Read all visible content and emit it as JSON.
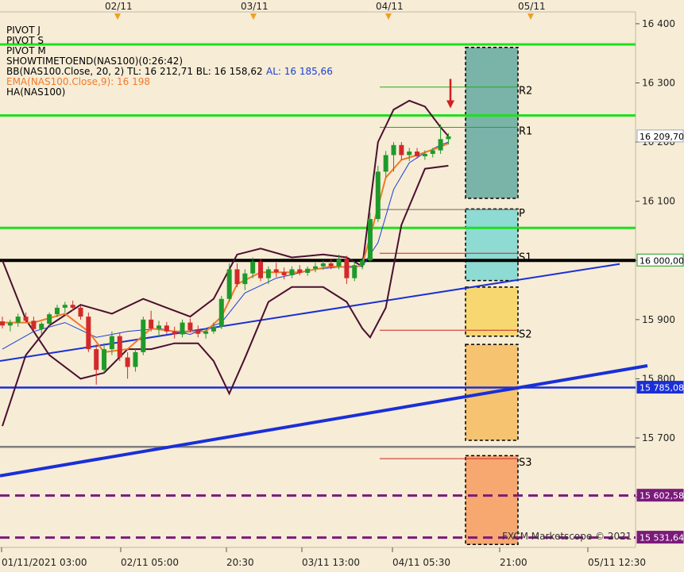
{
  "chart_data": {
    "type": "candlestick",
    "symbol": "NAS100",
    "legend": [
      {
        "text": "PIVOT J",
        "color": "#000000"
      },
      {
        "text": "PIVOT S",
        "color": "#000000"
      },
      {
        "text": "PIVOT M",
        "color": "#000000"
      },
      {
        "text": "SHOWTIMETOEND(NAS100)(0:26:42)",
        "color": "#000000"
      },
      {
        "text": "BB(NAS100.Close, 20, 2)  TL: 16 212,71  BL: 16 158,62",
        "color": "#000000",
        "extra": "AL: 16 185,66",
        "extra_color": "#1a3fd6"
      },
      {
        "text": "EMA(NAS100.Close,9): 16 198",
        "color": "#f07a2a"
      },
      {
        "text": "HA(NAS100)",
        "color": "#000000"
      }
    ],
    "ylim": [
      15515,
      16420
    ],
    "y_ticks": [
      "16 400",
      "16 300",
      "16 200",
      "16 100",
      "16 000",
      "15 900",
      "15 800",
      "15 700",
      "15 600"
    ],
    "y_tick_values": [
      16400,
      16300,
      16200,
      16100,
      16000,
      15900,
      15800,
      15700,
      15600
    ],
    "x_ticks": [
      "01/11/2021 03:00",
      "02/11 05:00",
      "20:30",
      "03/11 13:00",
      "04/11 05:30",
      "21:00",
      "05/11 12:30"
    ],
    "top_date_markers": [
      "02/11",
      "03/11",
      "04/11",
      "05/11"
    ],
    "price_tags": [
      {
        "label": "16 209,70",
        "value": 16209.7,
        "bg": "#ffffff",
        "fg": "#000000",
        "border": "#9ab"
      },
      {
        "label": "16 000,00",
        "value": 16000.0,
        "bg": "#ffffff",
        "fg": "#000000",
        "border": "#1a9a1a"
      },
      {
        "label": "15 785,08",
        "value": 15785.08,
        "bg": "#1a2fd6",
        "fg": "#ffffff",
        "border": "#1a2fd6"
      },
      {
        "label": "15 602,58",
        "value": 15602.58,
        "bg": "#7a1a7a",
        "fg": "#ffffff",
        "border": "#7a1a7a"
      },
      {
        "label": "15 531,64",
        "value": 15531.64,
        "bg": "#7a1a7a",
        "fg": "#ffffff",
        "border": "#7a1a7a"
      }
    ],
    "horizontal_lines": [
      {
        "value": 16365,
        "color": "#1ee01e",
        "style": "solid"
      },
      {
        "value": 16245,
        "color": "#1ee01e",
        "style": "solid"
      },
      {
        "value": 16055,
        "color": "#1ee01e",
        "style": "solid"
      },
      {
        "value": 16000,
        "color": "#000000",
        "style": "solid"
      },
      {
        "value": 15785.08,
        "color": "#1a2fd6",
        "style": "solid"
      },
      {
        "value": 15685,
        "color": "#808080",
        "style": "solid"
      },
      {
        "value": 15602.58,
        "color": "#7a1a7a",
        "style": "dashed"
      },
      {
        "value": 15531.64,
        "color": "#7a1a7a",
        "style": "dashed"
      }
    ],
    "pivot_levels": [
      {
        "label": "R2",
        "value": 16293,
        "line_color": "#22aa22"
      },
      {
        "label": "R1",
        "value": 16225,
        "line_color": "#22aa22"
      },
      {
        "label": "P",
        "value": 16086,
        "line_color": "#666666"
      },
      {
        "label": "S1",
        "value": 16012,
        "line_color": "#cc2222"
      },
      {
        "label": "S2",
        "value": 15882,
        "line_color": "#cc2222"
      },
      {
        "label": "S3",
        "value": 15665,
        "line_color": "#cc2222"
      }
    ],
    "pivot_zones": [
      {
        "from": 16105,
        "to": 16360,
        "color": "#7ab3a8"
      },
      {
        "from": 15966,
        "to": 16087,
        "color": "#8ddbd2"
      },
      {
        "from": 15872,
        "to": 15955,
        "color": "#f7d870"
      },
      {
        "from": 15696,
        "to": 15858,
        "color": "#f6c470"
      },
      {
        "from": 15520,
        "to": 15670,
        "color": "#f6a870"
      }
    ],
    "trendlines": [
      {
        "from": [
          0,
          15830
        ],
        "to": [
          780,
          15994
        ],
        "color": "#1a2fd6",
        "width": 2
      },
      {
        "from": [
          0,
          15636
        ],
        "to": [
          815,
          15822
        ],
        "color": "#1a2fd6",
        "width": 4
      }
    ],
    "candles": [
      {
        "i": 0,
        "o": 15897,
        "h": 15905,
        "l": 15885,
        "c": 15890
      },
      {
        "i": 1,
        "o": 15890,
        "h": 15900,
        "l": 15880,
        "c": 15895
      },
      {
        "i": 2,
        "o": 15895,
        "h": 15910,
        "l": 15888,
        "c": 15905
      },
      {
        "i": 3,
        "o": 15905,
        "h": 15912,
        "l": 15895,
        "c": 15898
      },
      {
        "i": 4,
        "o": 15898,
        "h": 15905,
        "l": 15880,
        "c": 15884
      },
      {
        "i": 5,
        "o": 15884,
        "h": 15896,
        "l": 15876,
        "c": 15893
      },
      {
        "i": 6,
        "o": 15893,
        "h": 15912,
        "l": 15889,
        "c": 15909
      },
      {
        "i": 7,
        "o": 15909,
        "h": 15925,
        "l": 15904,
        "c": 15920
      },
      {
        "i": 8,
        "o": 15920,
        "h": 15930,
        "l": 15912,
        "c": 15925
      },
      {
        "i": 9,
        "o": 15925,
        "h": 15932,
        "l": 15915,
        "c": 15920
      },
      {
        "i": 10,
        "o": 15920,
        "h": 15924,
        "l": 15900,
        "c": 15905
      },
      {
        "i": 11,
        "o": 15905,
        "h": 15912,
        "l": 15845,
        "c": 15850
      },
      {
        "i": 12,
        "o": 15850,
        "h": 15858,
        "l": 15790,
        "c": 15815
      },
      {
        "i": 13,
        "o": 15815,
        "h": 15860,
        "l": 15810,
        "c": 15850
      },
      {
        "i": 14,
        "o": 15850,
        "h": 15880,
        "l": 15840,
        "c": 15872
      },
      {
        "i": 15,
        "o": 15872,
        "h": 15878,
        "l": 15830,
        "c": 15836
      },
      {
        "i": 16,
        "o": 15836,
        "h": 15845,
        "l": 15800,
        "c": 15820
      },
      {
        "i": 17,
        "o": 15820,
        "h": 15850,
        "l": 15812,
        "c": 15845
      },
      {
        "i": 18,
        "o": 15845,
        "h": 15905,
        "l": 15840,
        "c": 15900
      },
      {
        "i": 19,
        "o": 15900,
        "h": 15915,
        "l": 15880,
        "c": 15885
      },
      {
        "i": 20,
        "o": 15885,
        "h": 15898,
        "l": 15870,
        "c": 15890
      },
      {
        "i": 21,
        "o": 15890,
        "h": 15896,
        "l": 15876,
        "c": 15880
      },
      {
        "i": 22,
        "o": 15880,
        "h": 15888,
        "l": 15868,
        "c": 15875
      },
      {
        "i": 23,
        "o": 15875,
        "h": 15900,
        "l": 15870,
        "c": 15895
      },
      {
        "i": 24,
        "o": 15895,
        "h": 15902,
        "l": 15878,
        "c": 15882
      },
      {
        "i": 25,
        "o": 15882,
        "h": 15890,
        "l": 15870,
        "c": 15876
      },
      {
        "i": 26,
        "o": 15876,
        "h": 15885,
        "l": 15868,
        "c": 15880
      },
      {
        "i": 27,
        "o": 15880,
        "h": 15895,
        "l": 15876,
        "c": 15888
      },
      {
        "i": 28,
        "o": 15888,
        "h": 15940,
        "l": 15884,
        "c": 15935
      },
      {
        "i": 29,
        "o": 15935,
        "h": 15995,
        "l": 15930,
        "c": 15985
      },
      {
        "i": 30,
        "o": 15985,
        "h": 15995,
        "l": 15955,
        "c": 15960
      },
      {
        "i": 31,
        "o": 15960,
        "h": 15985,
        "l": 15950,
        "c": 15978
      },
      {
        "i": 32,
        "o": 15978,
        "h": 16005,
        "l": 15970,
        "c": 15998
      },
      {
        "i": 33,
        "o": 15998,
        "h": 16003,
        "l": 15965,
        "c": 15970
      },
      {
        "i": 34,
        "o": 15970,
        "h": 15990,
        "l": 15960,
        "c": 15985
      },
      {
        "i": 35,
        "o": 15985,
        "h": 15996,
        "l": 15972,
        "c": 15980
      },
      {
        "i": 36,
        "o": 15980,
        "h": 15988,
        "l": 15968,
        "c": 15975
      },
      {
        "i": 37,
        "o": 15975,
        "h": 15990,
        "l": 15970,
        "c": 15985
      },
      {
        "i": 38,
        "o": 15985,
        "h": 15992,
        "l": 15975,
        "c": 15979
      },
      {
        "i": 39,
        "o": 15979,
        "h": 15990,
        "l": 15974,
        "c": 15986
      },
      {
        "i": 40,
        "o": 15986,
        "h": 15996,
        "l": 15980,
        "c": 15990
      },
      {
        "i": 41,
        "o": 15990,
        "h": 16000,
        "l": 15984,
        "c": 15995
      },
      {
        "i": 42,
        "o": 15995,
        "h": 16003,
        "l": 15985,
        "c": 15990
      },
      {
        "i": 43,
        "o": 15990,
        "h": 16010,
        "l": 15985,
        "c": 16002
      },
      {
        "i": 44,
        "o": 16002,
        "h": 16008,
        "l": 15960,
        "c": 15970
      },
      {
        "i": 45,
        "o": 15970,
        "h": 15998,
        "l": 15965,
        "c": 15992
      },
      {
        "i": 46,
        "o": 15992,
        "h": 16005,
        "l": 15985,
        "c": 16000
      },
      {
        "i": 47,
        "o": 16000,
        "h": 16080,
        "l": 15998,
        "c": 16070
      },
      {
        "i": 48,
        "o": 16070,
        "h": 16160,
        "l": 16065,
        "c": 16150
      },
      {
        "i": 49,
        "o": 16150,
        "h": 16185,
        "l": 16140,
        "c": 16178
      },
      {
        "i": 50,
        "o": 16178,
        "h": 16200,
        "l": 16150,
        "c": 16195
      },
      {
        "i": 51,
        "o": 16195,
        "h": 16200,
        "l": 16170,
        "c": 16178
      },
      {
        "i": 52,
        "o": 16178,
        "h": 16190,
        "l": 16168,
        "c": 16184
      },
      {
        "i": 53,
        "o": 16184,
        "h": 16190,
        "l": 16172,
        "c": 16176
      },
      {
        "i": 54,
        "o": 16176,
        "h": 16186,
        "l": 16170,
        "c": 16180
      },
      {
        "i": 55,
        "o": 16180,
        "h": 16190,
        "l": 16174,
        "c": 16186
      },
      {
        "i": 56,
        "o": 16186,
        "h": 16230,
        "l": 16180,
        "c": 16205
      },
      {
        "i": 57,
        "o": 16205,
        "h": 16215,
        "l": 16196,
        "c": 16209.7
      }
    ],
    "bb_upper": [
      [
        0,
        15720
      ],
      [
        3,
        15840
      ],
      [
        6,
        15890
      ],
      [
        10,
        15925
      ],
      [
        14,
        15910
      ],
      [
        18,
        15935
      ],
      [
        21,
        15920
      ],
      [
        24,
        15905
      ],
      [
        27,
        15935
      ],
      [
        30,
        16010
      ],
      [
        33,
        16020
      ],
      [
        37,
        16005
      ],
      [
        41,
        16010
      ],
      [
        44,
        16005
      ],
      [
        46,
        15990
      ],
      [
        48,
        16200
      ],
      [
        50,
        16255
      ],
      [
        52,
        16270
      ],
      [
        54,
        16260
      ],
      [
        56,
        16225
      ],
      [
        57,
        16210
      ]
    ],
    "bb_lower": [
      [
        0,
        16000
      ],
      [
        3,
        15900
      ],
      [
        6,
        15840
      ],
      [
        10,
        15800
      ],
      [
        13,
        15810
      ],
      [
        16,
        15850
      ],
      [
        19,
        15850
      ],
      [
        22,
        15860
      ],
      [
        25,
        15860
      ],
      [
        27,
        15830
      ],
      [
        29,
        15775
      ],
      [
        31,
        15835
      ],
      [
        34,
        15930
      ],
      [
        37,
        15955
      ],
      [
        41,
        15955
      ],
      [
        44,
        15930
      ],
      [
        46,
        15885
      ],
      [
        47,
        15870
      ],
      [
        49,
        15920
      ],
      [
        51,
        16060
      ],
      [
        54,
        16155
      ],
      [
        57,
        16160
      ]
    ],
    "bb_mid": [
      [
        0,
        15850
      ],
      [
        4,
        15880
      ],
      [
        8,
        15895
      ],
      [
        12,
        15870
      ],
      [
        16,
        15880
      ],
      [
        20,
        15885
      ],
      [
        24,
        15875
      ],
      [
        28,
        15895
      ],
      [
        31,
        15945
      ],
      [
        35,
        15970
      ],
      [
        40,
        15985
      ],
      [
        44,
        15990
      ],
      [
        46,
        15990
      ],
      [
        48,
        16030
      ],
      [
        50,
        16120
      ],
      [
        52,
        16165
      ],
      [
        54,
        16182
      ],
      [
        56,
        16195
      ],
      [
        57,
        16200
      ]
    ],
    "ema": [
      [
        0,
        15895
      ],
      [
        4,
        15895
      ],
      [
        8,
        15910
      ],
      [
        11,
        15880
      ],
      [
        13,
        15845
      ],
      [
        16,
        15850
      ],
      [
        19,
        15885
      ],
      [
        22,
        15880
      ],
      [
        26,
        15880
      ],
      [
        28,
        15905
      ],
      [
        30,
        15960
      ],
      [
        33,
        15980
      ],
      [
        38,
        15980
      ],
      [
        42,
        15990
      ],
      [
        45,
        15988
      ],
      [
        46,
        15993
      ],
      [
        47,
        16040
      ],
      [
        48,
        16090
      ],
      [
        49,
        16140
      ],
      [
        51,
        16170
      ],
      [
        53,
        16178
      ],
      [
        56,
        16192
      ],
      [
        57,
        16198
      ]
    ],
    "signal_arrow": {
      "at": 16300,
      "color": "#d02020"
    },
    "watermark": "FXCM Marketscope © 2021"
  }
}
